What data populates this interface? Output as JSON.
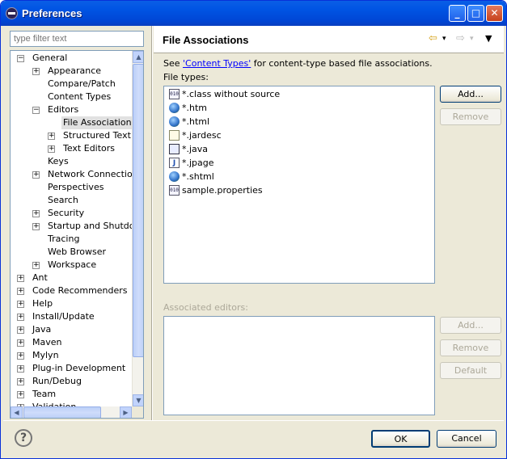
{
  "window": {
    "title": "Preferences",
    "min_glyph": "_",
    "max_glyph": "□",
    "close_glyph": "✕"
  },
  "filter": {
    "placeholder": "type filter text"
  },
  "tree": [
    {
      "label": "General",
      "indent": 0,
      "expander": "−"
    },
    {
      "label": "Appearance",
      "indent": 1,
      "expander": "+"
    },
    {
      "label": "Compare/Patch",
      "indent": 1,
      "expander": ""
    },
    {
      "label": "Content Types",
      "indent": 1,
      "expander": ""
    },
    {
      "label": "Editors",
      "indent": 1,
      "expander": "−"
    },
    {
      "label": "File Associations",
      "indent": 2,
      "expander": "",
      "selected": true
    },
    {
      "label": "Structured Text Ed",
      "indent": 2,
      "expander": "+"
    },
    {
      "label": "Text Editors",
      "indent": 2,
      "expander": "+"
    },
    {
      "label": "Keys",
      "indent": 1,
      "expander": ""
    },
    {
      "label": "Network Connections",
      "indent": 1,
      "expander": "+"
    },
    {
      "label": "Perspectives",
      "indent": 1,
      "expander": ""
    },
    {
      "label": "Search",
      "indent": 1,
      "expander": ""
    },
    {
      "label": "Security",
      "indent": 1,
      "expander": "+"
    },
    {
      "label": "Startup and Shutdown",
      "indent": 1,
      "expander": "+"
    },
    {
      "label": "Tracing",
      "indent": 1,
      "expander": ""
    },
    {
      "label": "Web Browser",
      "indent": 1,
      "expander": ""
    },
    {
      "label": "Workspace",
      "indent": 1,
      "expander": "+"
    },
    {
      "label": "Ant",
      "indent": 0,
      "expander": "+"
    },
    {
      "label": "Code Recommenders",
      "indent": 0,
      "expander": "+"
    },
    {
      "label": "Help",
      "indent": 0,
      "expander": "+"
    },
    {
      "label": "Install/Update",
      "indent": 0,
      "expander": "+"
    },
    {
      "label": "Java",
      "indent": 0,
      "expander": "+"
    },
    {
      "label": "Maven",
      "indent": 0,
      "expander": "+"
    },
    {
      "label": "Mylyn",
      "indent": 0,
      "expander": "+"
    },
    {
      "label": "Plug-in Development",
      "indent": 0,
      "expander": "+"
    },
    {
      "label": "Run/Debug",
      "indent": 0,
      "expander": "+"
    },
    {
      "label": "Team",
      "indent": 0,
      "expander": "+"
    },
    {
      "label": "Validation",
      "indent": 0,
      "expander": "+"
    }
  ],
  "page": {
    "title": "File Associations",
    "see_prefix": "See ",
    "see_link": "'Content Types'",
    "see_suffix": " for content-type based file associations.",
    "file_types_label": "File types:",
    "associated_editors_label": "Associated editors:"
  },
  "file_types": [
    {
      "name": "*.class without source",
      "icon": "binary-file-icon"
    },
    {
      "name": "*.htm",
      "icon": "globe-icon"
    },
    {
      "name": "*.html",
      "icon": "globe-icon"
    },
    {
      "name": "*.jardesc",
      "icon": "jar-description-icon"
    },
    {
      "name": "*.java",
      "icon": "java-file-icon"
    },
    {
      "name": "*.jpage",
      "icon": "java-page-icon"
    },
    {
      "name": "*.shtml",
      "icon": "globe-icon"
    },
    {
      "name": "sample.properties",
      "icon": "properties-file-icon"
    }
  ],
  "buttons": {
    "add_types": "Add...",
    "remove_types": "Remove",
    "add_editor": "Add...",
    "remove_editor": "Remove",
    "default_editor": "Default",
    "ok": "OK",
    "cancel": "Cancel",
    "help": "?"
  },
  "nav": {
    "back": "⇦",
    "forward": "⇨",
    "dropdown": "▾",
    "menu": "▼"
  },
  "colors": {
    "title_bar": "#0054e3",
    "selection": "#e1e1e1",
    "link": "#0000ff"
  }
}
